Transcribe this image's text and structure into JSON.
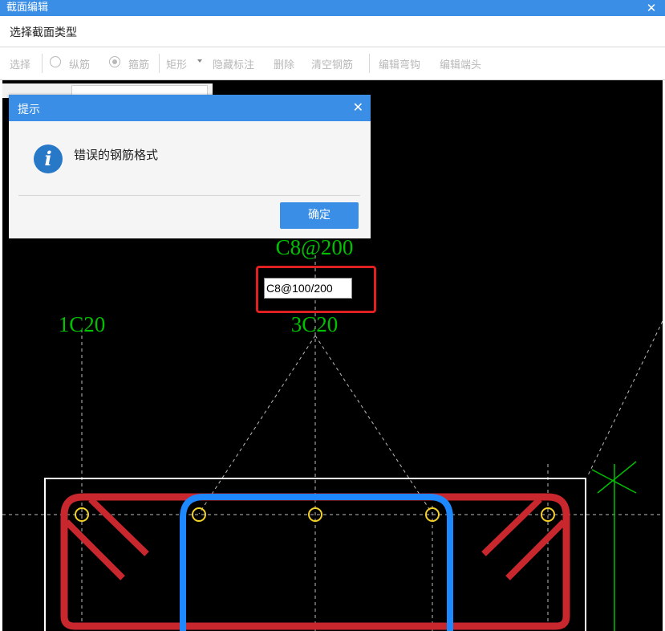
{
  "window": {
    "title": "截面编辑",
    "close_glyph": "✕"
  },
  "section_type": {
    "label": "选择截面类型"
  },
  "toolbar": {
    "select": "选择",
    "longitudinal": "纵筋",
    "stirrup": "箍筋",
    "shape": "矩形",
    "hide_labels": "隐藏标注",
    "delete": "删除",
    "clear_rebar": "清空钢筋",
    "edit_hook": "编辑弯钩",
    "edit_end": "编辑端头",
    "stirrup_checked": true,
    "longitudinal_checked": false
  },
  "canvas": {
    "label_stirrup": "C8@200",
    "label_left": "1C20",
    "label_top": "3C20",
    "edit_value": "C8@100/200",
    "colors": {
      "stirrup_outer": "#c8282d",
      "stirrup_inner": "#1e88ff",
      "rebar": "#f2d12a",
      "labels": "#00c000",
      "section": "#ffffff"
    }
  },
  "dialog": {
    "title": "提示",
    "close_glyph": "✕",
    "icon_glyph": "i",
    "message": "错误的钢筋格式",
    "ok_label": "确定"
  }
}
